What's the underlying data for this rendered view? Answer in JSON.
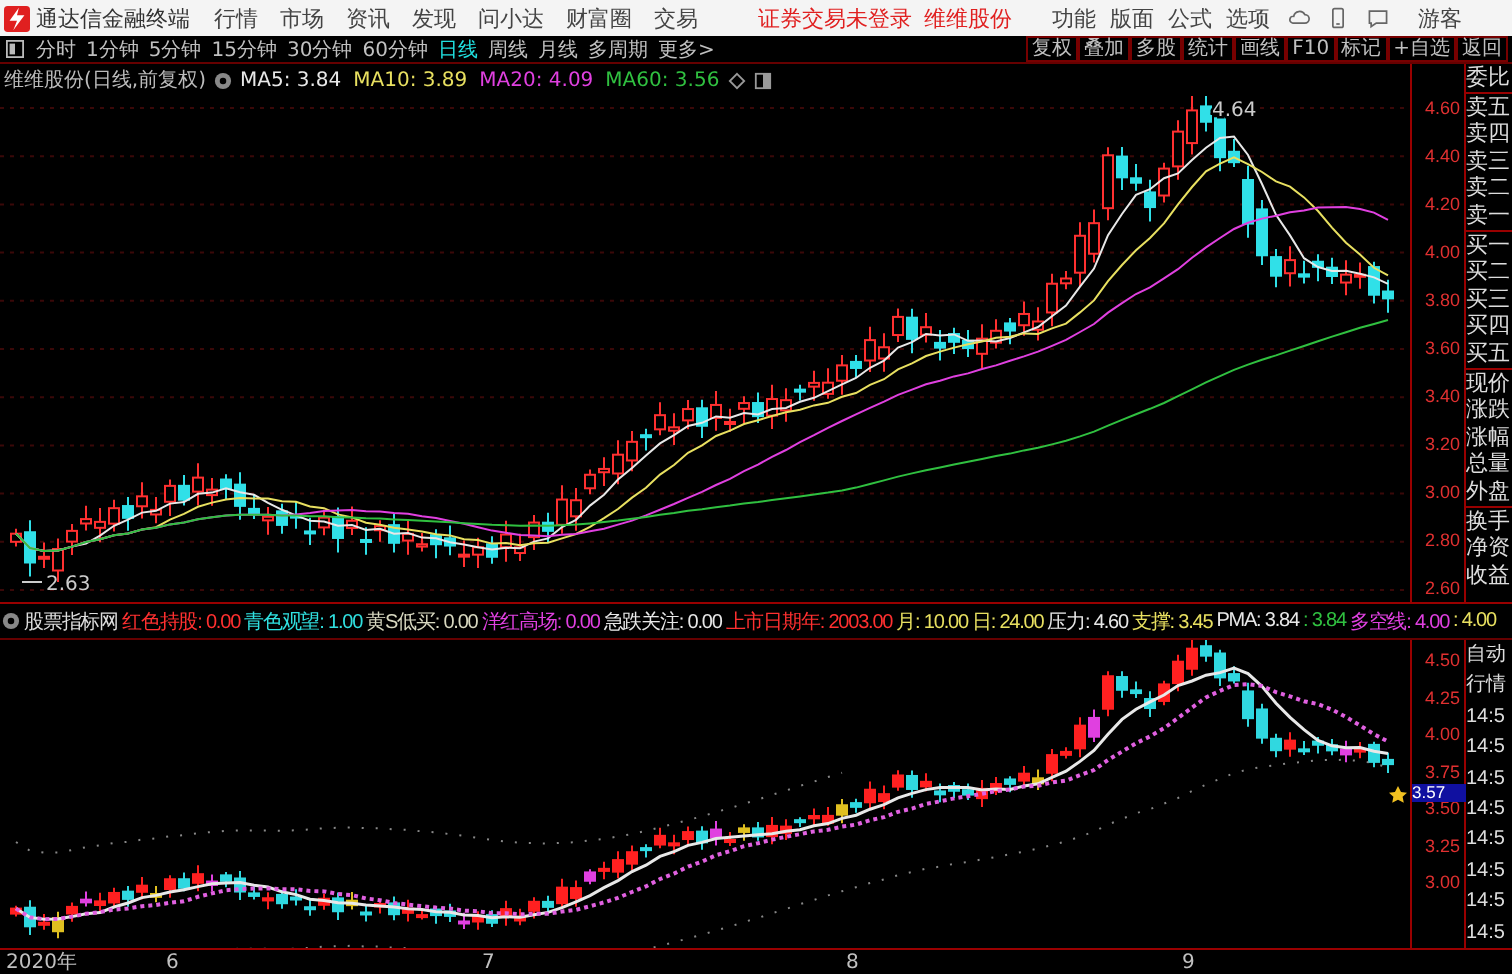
{
  "app": {
    "title": "通达信金融终端"
  },
  "menu": [
    "行情",
    "市场",
    "资讯",
    "发现",
    "问小达",
    "财富圈",
    "交易"
  ],
  "notice": [
    "证券交易未登录",
    "维维股份"
  ],
  "right_menu": [
    "功能",
    "版面",
    "公式",
    "选项"
  ],
  "user": "游客",
  "periods": [
    {
      "label": "分时",
      "selected": false
    },
    {
      "label": "1分钟",
      "selected": false
    },
    {
      "label": "5分钟",
      "selected": false
    },
    {
      "label": "15分钟",
      "selected": false
    },
    {
      "label": "30分钟",
      "selected": false
    },
    {
      "label": "60分钟",
      "selected": false
    },
    {
      "label": "日线",
      "selected": true
    },
    {
      "label": "周线",
      "selected": false
    },
    {
      "label": "月线",
      "selected": false
    },
    {
      "label": "多周期",
      "selected": false
    },
    {
      "label": "更多>",
      "selected": false
    }
  ],
  "tools": [
    "复权",
    "叠加",
    "多股",
    "统计",
    "画线",
    "F10",
    "标记",
    "+自选",
    "返回"
  ],
  "chart": {
    "title": "维维股份(日线,前复权)",
    "ma": [
      {
        "text": "MA5: 3.84",
        "color": "#e8e8e8"
      },
      {
        "text": "MA10: 3.89",
        "color": "#e8e060"
      },
      {
        "text": "MA20: 4.09",
        "color": "#e040e0"
      },
      {
        "text": "MA60: 3.56",
        "color": "#30c040"
      }
    ],
    "high_label": "4.64",
    "low_label": "2.63",
    "price_ticks": [
      "4.60",
      "4.40",
      "4.20",
      "4.00",
      "3.80",
      "3.60",
      "3.40",
      "3.20",
      "3.00",
      "2.80",
      "2.60"
    ]
  },
  "side_panel": [
    [
      "委比"
    ],
    [
      "卖五",
      "卖四",
      "卖三",
      "卖二",
      "卖一"
    ],
    [
      "买一",
      "买二",
      "买三",
      "买四",
      "买五"
    ],
    [
      "现价",
      "涨跌",
      "涨幅",
      "总量",
      "外盘"
    ],
    [
      "换手",
      "净资",
      "收益"
    ]
  ],
  "indicator": {
    "title": "股票指标网",
    "items": [
      {
        "text": "红色持股: 0.00",
        "color": "#ff3030"
      },
      {
        "text": "青色观望: 1.00",
        "color": "#30e0e0"
      },
      {
        "text": "黄S低买: 0.00",
        "color": "#d8d8c0"
      },
      {
        "text": "洋红高场: 0.00",
        "color": "#e040e0"
      },
      {
        "text": "急跌关注: 0.00",
        "color": "#e8e8e8"
      },
      {
        "text": "上市日期年: 2003.00",
        "color": "#ff3030"
      },
      {
        "text": "月: 10.00",
        "color": "#e8e060"
      },
      {
        "text": "日: 24.00",
        "color": "#e8e060"
      },
      {
        "text": "压力: 4.60",
        "color": "#e8e8e8"
      },
      {
        "text": "支撑: 3.45",
        "color": "#e8e060"
      },
      {
        "text": "PMA: 3.84",
        "color": "#e8e8e8"
      },
      {
        "text": ": 3.84",
        "color": "#30c040"
      },
      {
        "text": "多空线: 4.00",
        "color": "#e040e0"
      },
      {
        "text": ": 4.00",
        "color": "#e8e060"
      }
    ],
    "price_ticks": [
      "4.50",
      "4.25",
      "4.00",
      "3.75",
      "3.50",
      "3.25",
      "3.00"
    ],
    "last_price": "3.57"
  },
  "side_lower": [
    "自动",
    "行情",
    "14:5",
    "14:5",
    "14:5",
    "14:5",
    "14:5",
    "14:5",
    "14:5",
    "14:5"
  ],
  "date_axis": [
    "2020年",
    "6",
    "7",
    "8",
    "9"
  ]
}
